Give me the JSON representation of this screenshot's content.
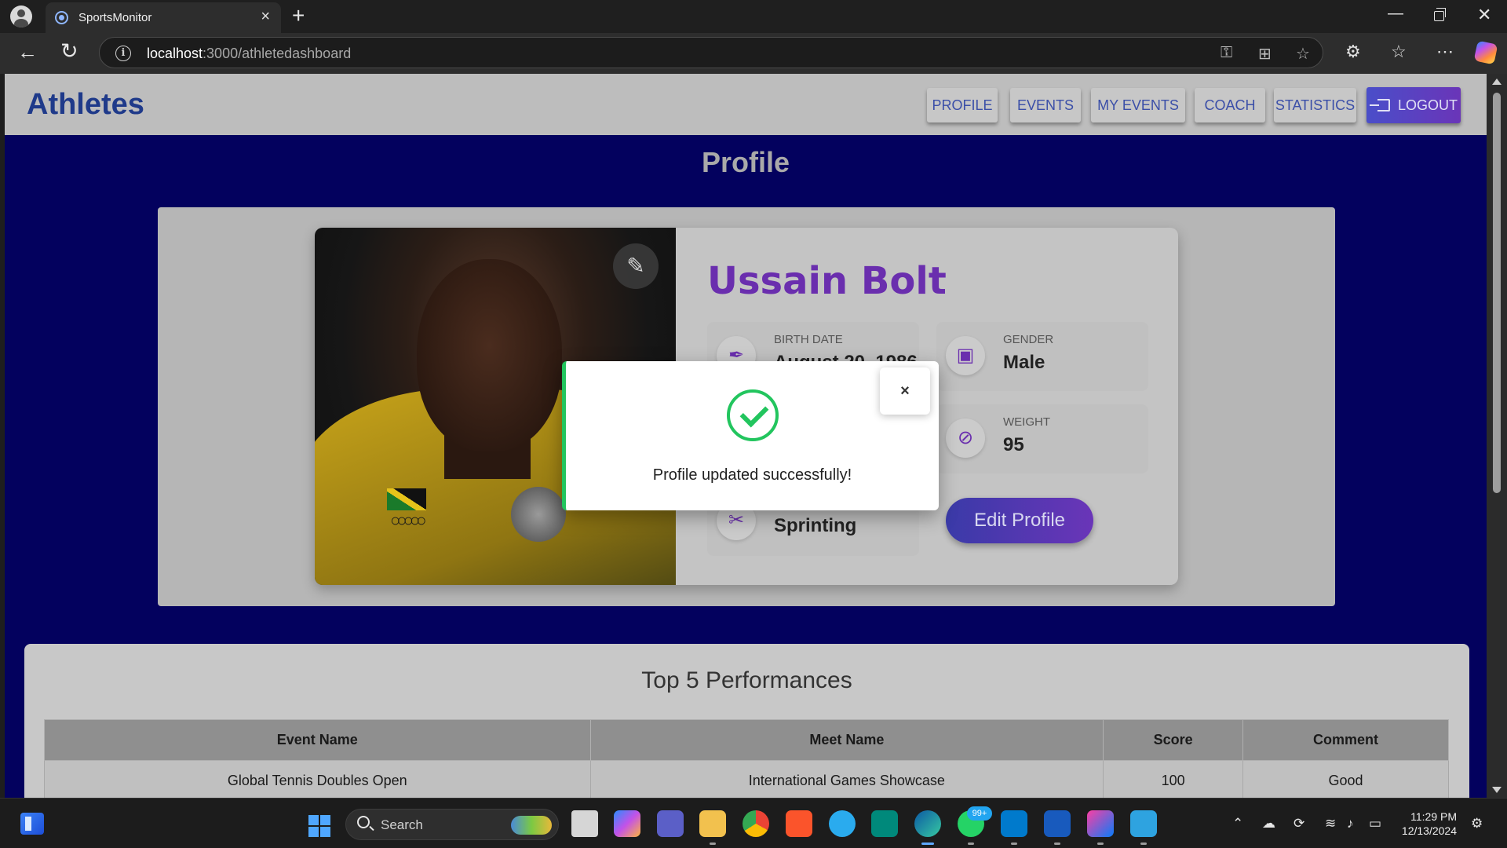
{
  "browser": {
    "tab_title": "SportsMonitor",
    "url_host": "localhost",
    "url_rest": ":3000/athletedashboard"
  },
  "navbar": {
    "brand": "Athletes",
    "items": [
      {
        "label": "PROFILE"
      },
      {
        "label": "EVENTS"
      },
      {
        "label": "MY EVENTS"
      },
      {
        "label": "COACH"
      },
      {
        "label": "STATISTICS"
      }
    ],
    "logout_label": "LOGOUT"
  },
  "profile": {
    "page_title": "Profile",
    "name": "Ussain Bolt",
    "fields": {
      "birth_date": {
        "label": "BIRTH DATE",
        "value": "August 20, 1986"
      },
      "gender": {
        "label": "GENDER",
        "value": "Male"
      },
      "weight": {
        "label": "WEIGHT",
        "value": "95"
      },
      "sport": {
        "value": "Sprinting"
      }
    },
    "edit_button": "Edit Profile"
  },
  "performances": {
    "title": "Top 5 Performances",
    "columns": [
      "Event Name",
      "Meet Name",
      "Score",
      "Comment"
    ],
    "rows": [
      [
        "Global Tennis Doubles Open",
        "International Games Showcase",
        "100",
        "Good"
      ]
    ]
  },
  "modal": {
    "message": "Profile updated successfully!",
    "close_label": "×"
  },
  "taskbar": {
    "search_label": "Search",
    "notification_badge": "99+",
    "time": "11:29 PM",
    "date": "12/13/2024"
  },
  "colors": {
    "page_bg": "#03015e",
    "accent_purple": "#6a2eae",
    "success_green": "#22c55e",
    "brand_blue": "#1f3a8a"
  }
}
